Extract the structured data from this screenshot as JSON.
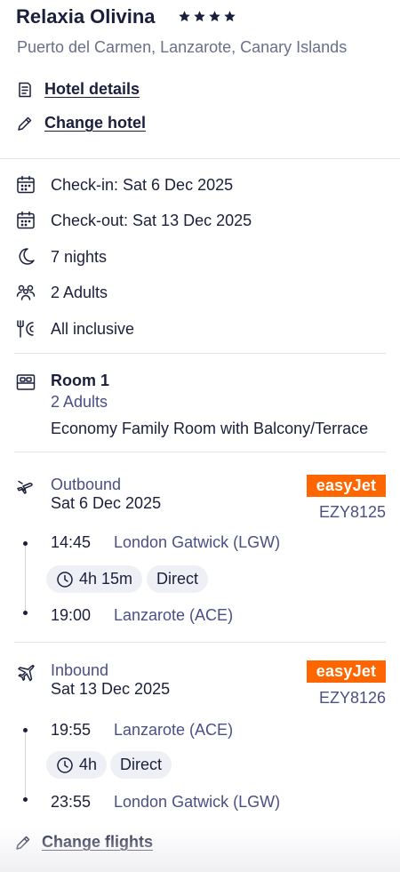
{
  "hotel": {
    "name": "Relaxia Olivina",
    "star_rating": 4,
    "location": "Puerto del Carmen, Lanzarote, Canary Islands",
    "details_link": "Hotel details",
    "change_link": "Change hotel"
  },
  "stay": {
    "checkin": "Check-in: Sat 6 Dec 2025",
    "checkout": "Check-out: Sat 13 Dec 2025",
    "nights": "7 nights",
    "guests": "2 Adults",
    "board": "All inclusive"
  },
  "room": {
    "title": "Room 1",
    "occupancy": "2 Adults",
    "type": "Economy Family Room with Balcony/Terrace"
  },
  "outbound": {
    "label": "Outbound",
    "date": "Sat 6 Dec 2025",
    "airline": "easyJet",
    "flight_number": "EZY8125",
    "depart_time": "14:45",
    "depart_airport": "London Gatwick (LGW)",
    "duration": "4h 15m",
    "stops": "Direct",
    "arrive_time": "19:00",
    "arrive_airport": "Lanzarote (ACE)"
  },
  "inbound": {
    "label": "Inbound",
    "date": "Sat 13 Dec 2025",
    "airline": "easyJet",
    "flight_number": "EZY8126",
    "depart_time": "19:55",
    "depart_airport": "Lanzarote (ACE)",
    "duration": "4h",
    "stops": "Direct",
    "arrive_time": "23:55",
    "arrive_airport": "London Gatwick (LGW)"
  },
  "change_flights_link": "Change flights",
  "colors": {
    "text": "#1b1f3b",
    "secondary_text": "#4a4f86",
    "easyjet_orange": "#ff6600",
    "pill_bg": "#eef0f5"
  }
}
